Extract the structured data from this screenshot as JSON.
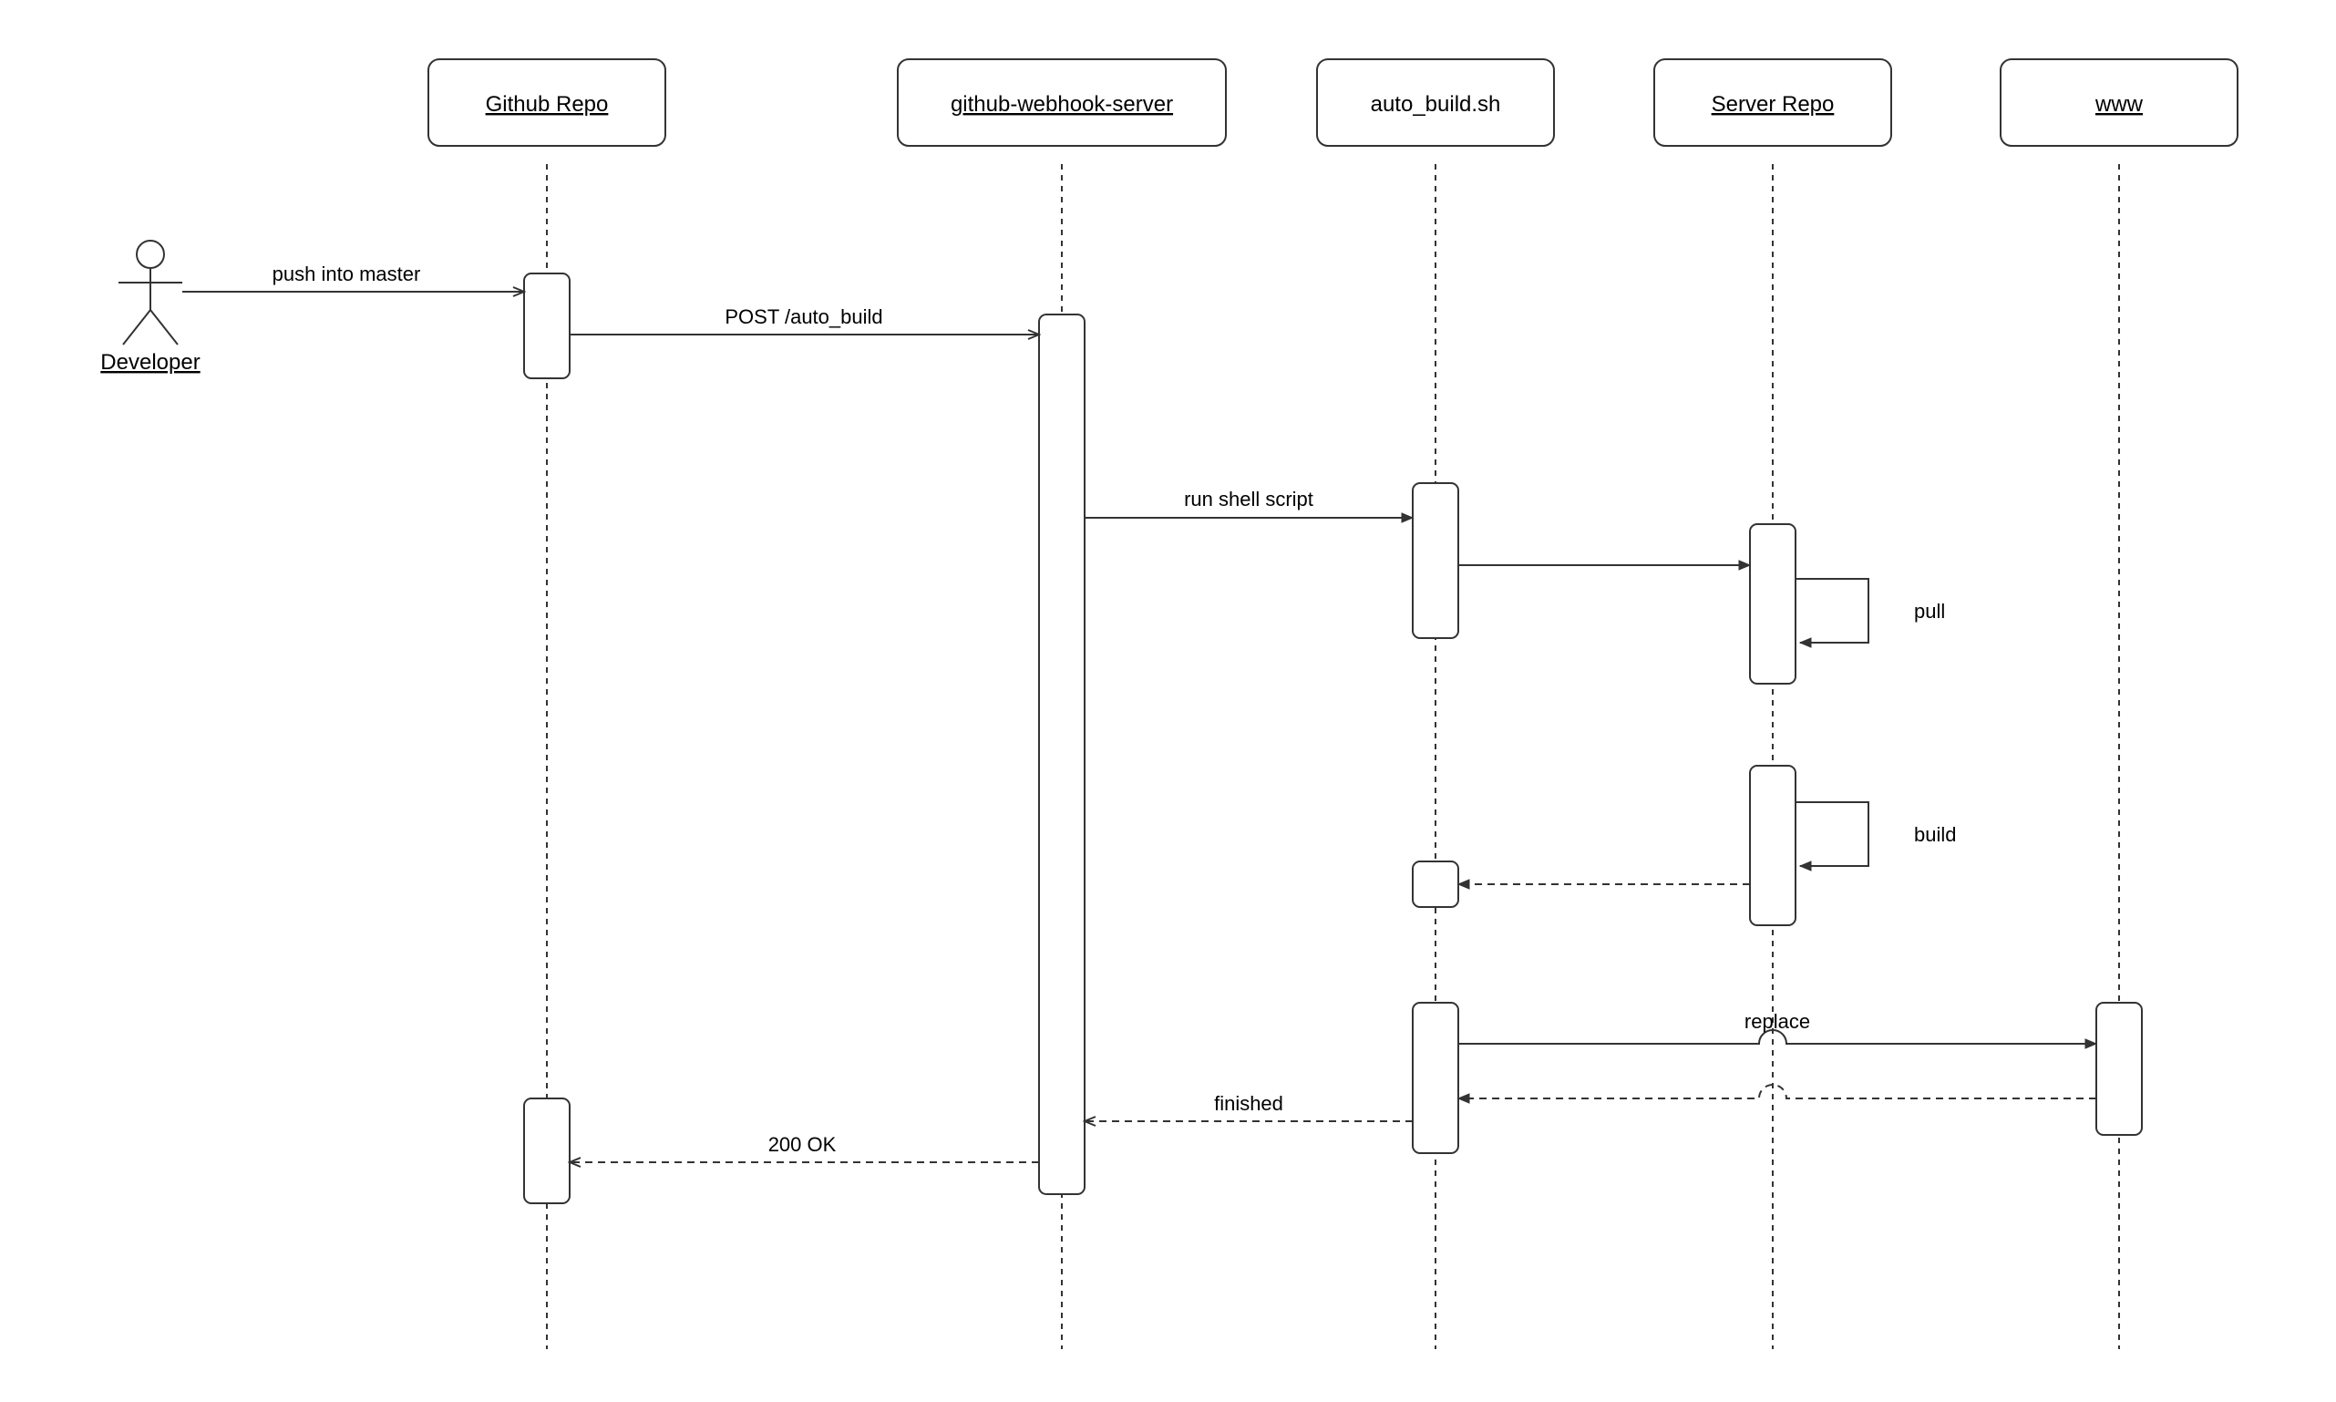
{
  "actor": {
    "name": "Developer"
  },
  "participants": [
    {
      "key": "github",
      "label": "Github Repo",
      "underline": true
    },
    {
      "key": "webhook",
      "label": "github-webhook-server",
      "underline": true
    },
    {
      "key": "script",
      "label": "auto_build.sh",
      "underline": false
    },
    {
      "key": "srvrepo",
      "label": "Server Repo",
      "underline": true
    },
    {
      "key": "www",
      "label": "www",
      "underline": true
    }
  ],
  "messages": {
    "push": "push into master",
    "post": "POST  /auto_build",
    "run": "run shell script",
    "pull": "pull",
    "build": "build",
    "replace": "replace",
    "finished": "finished",
    "ok": "200 OK"
  }
}
